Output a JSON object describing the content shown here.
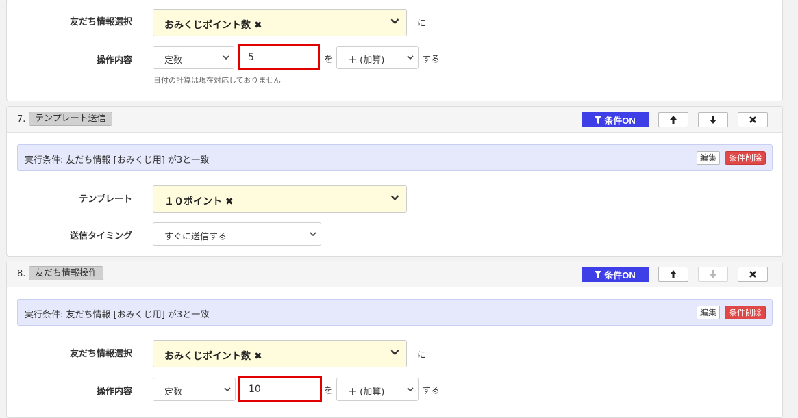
{
  "top_block": {
    "friend_info_label": "友だち情報選択",
    "friend_info_value": "おみくじポイント数 ✖",
    "suffix_ni": "に",
    "operation_label": "操作内容",
    "mode_value": "定数",
    "amount_value": "5",
    "suffix_wo": "を",
    "op_value": "＋ (加算)",
    "suffix_suru": "する",
    "note": "日付の計算は現在対応しておりません"
  },
  "step7": {
    "number": "7.",
    "tag": "テンプレート送信",
    "cond_on_label": "条件ON",
    "exec_condition": "実行条件: 友だち情報 [おみくじ用] が3と一致",
    "edit_label": "編集",
    "delete_cond_label": "条件削除",
    "template_label": "テンプレート",
    "template_value": "１０ポイント ✖",
    "timing_label": "送信タイミング",
    "timing_value": "すぐに送信する"
  },
  "step8": {
    "number": "8.",
    "tag": "友だち情報操作",
    "cond_on_label": "条件ON",
    "exec_condition": "実行条件: 友だち情報 [おみくじ用] が3と一致",
    "edit_label": "編集",
    "delete_cond_label": "条件削除",
    "friend_info_label": "友だち情報選択",
    "friend_info_value": "おみくじポイント数 ✖",
    "suffix_ni": "に",
    "operation_label": "操作内容",
    "mode_value": "定数",
    "amount_value": "10",
    "suffix_wo": "を",
    "op_value": "＋ (加算)",
    "suffix_suru": "する"
  },
  "colors": {
    "cond_on_blue": "#3f3fe8",
    "delete_red": "#e04848",
    "highlight_red": "#e00000",
    "select_yellow": "#fffbdd",
    "exec_bar": "#e6e9fb"
  },
  "icons": {
    "filter": "filter-icon",
    "up": "arrow-up-icon",
    "down": "arrow-down-icon",
    "close": "close-icon",
    "chevron": "chevron-down-icon"
  }
}
